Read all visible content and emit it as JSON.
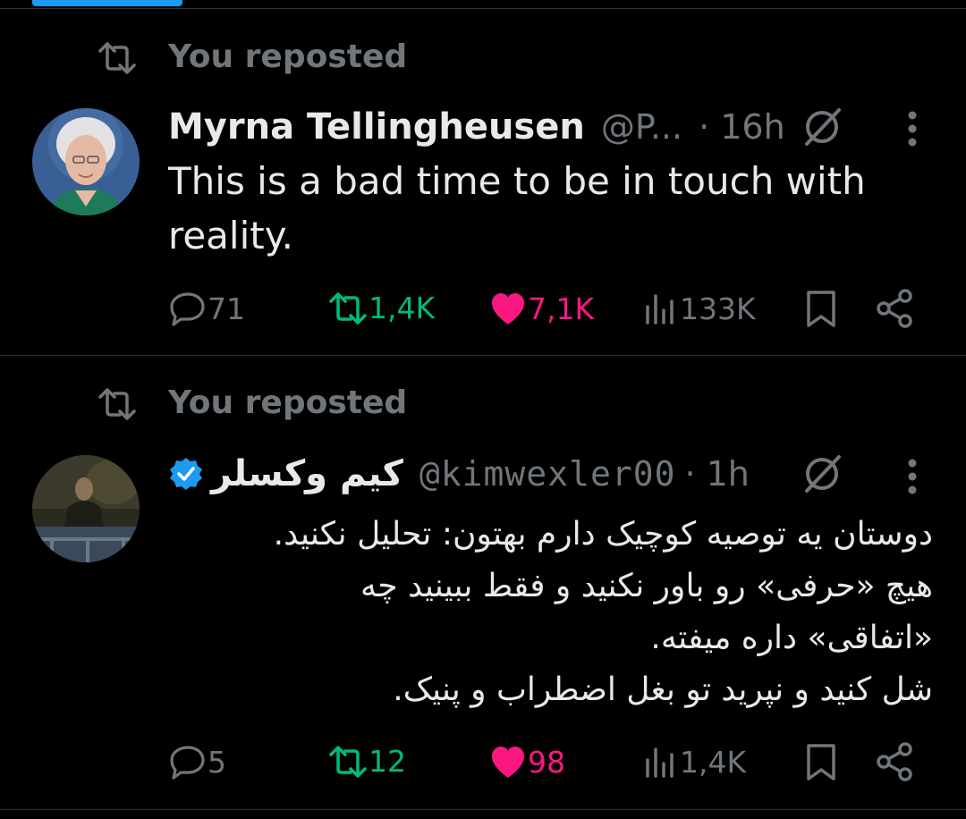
{
  "tweets": [
    {
      "repost_label": "You reposted",
      "name": "Myrna Tellingheusen",
      "handle": "@P...",
      "time": "· 16h",
      "text_lines": [
        "This is a bad time to be in touch with",
        "reality."
      ],
      "stats": {
        "replies": "71",
        "reposts": "1,4K",
        "likes": "7,1K",
        "views": "133K"
      }
    },
    {
      "repost_label": "You reposted",
      "name": "کیم وکسلر",
      "handle": "@kimwexler00",
      "time": "· 1h",
      "verified": true,
      "text_lines": [
        "دوستان یه توصیه کوچیک دارم بهتون: تحلیل نکنید.",
        "هیچ «حرفی» رو باور نکنید و فقط ببینید چه",
        "«اتفاقی» داره میفته.",
        "شل کنید و نپرید تو بغل اضطراب و پنیک."
      ],
      "stats": {
        "replies": "5",
        "reposts": "12",
        "likes": "98",
        "views": "1,4K"
      }
    }
  ],
  "colors": {
    "background": "#000000",
    "repost_green": "#00ba7c",
    "like_pink": "#f91880",
    "muted": "#71767b",
    "verified_blue": "#1d9bf0"
  },
  "icons": [
    "repost-icon",
    "reply-icon",
    "like-icon",
    "views-icon",
    "bookmark-icon",
    "share-icon",
    "grok-icon",
    "more-icon",
    "verified-badge-icon"
  ]
}
